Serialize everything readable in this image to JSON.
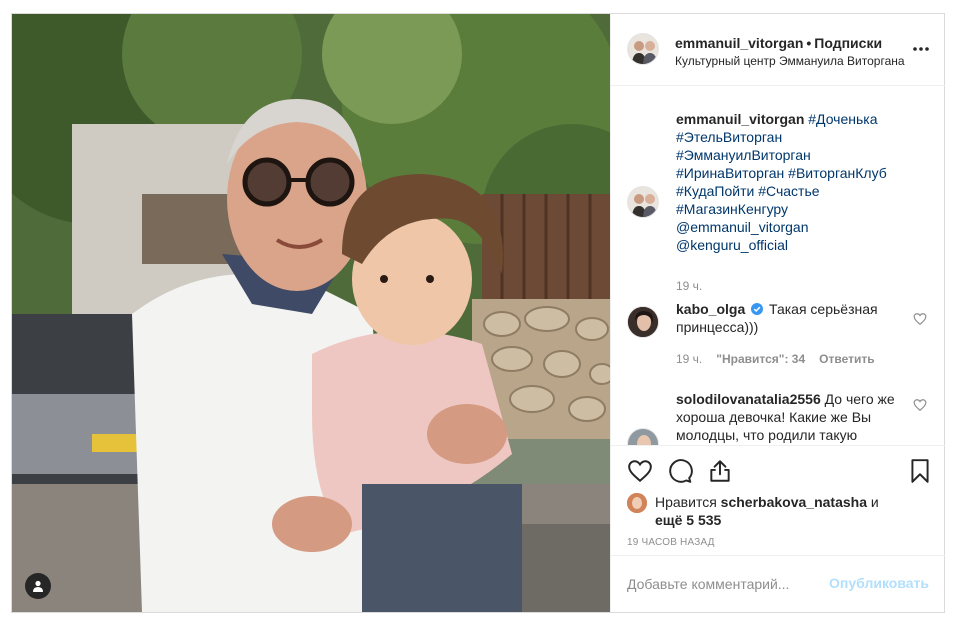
{
  "header": {
    "username": "emmanuil_vitorgan",
    "separator": "•",
    "follow_label": "Подписки",
    "location": "Культурный центр Эммануила Виторгана",
    "more_icon": "more-horizontal-icon"
  },
  "caption": {
    "username": "emmanuil_vitorgan",
    "tags": [
      "#Доченька",
      "#ЭтельВиторган",
      "#ЭммануилВиторган",
      "#ИринаВиторган",
      "#ВиторганКлуб",
      "#КудаПойти",
      "#Счастье",
      "#МагазинКенгуру",
      "@emmanuil_vitorgan",
      "@kenguru_official"
    ],
    "time": "19 ч."
  },
  "comments": [
    {
      "username": "kabo_olga",
      "verified": true,
      "text": "Такая серьёзная принцесса)))",
      "time": "19 ч.",
      "likes": "\"Нравится\": 34",
      "reply": "Ответить"
    },
    {
      "username": "solodilovanatalia2556",
      "verified": false,
      "text": "До чего же хороша девочка! Какие же Вы молодцы, что родили такую"
    }
  ],
  "actions": {
    "like_icon": "heart-icon",
    "comment_icon": "comment-icon",
    "share_icon": "share-icon",
    "save_icon": "bookmark-icon",
    "likes_prefix": "Нравится",
    "likes_user": "scherbakova_natasha",
    "likes_mid": "и",
    "likes_count": "ещё 5 535",
    "timestamp": "19 часов назад"
  },
  "add_comment": {
    "placeholder": "Добавьте комментарий...",
    "post_label": "Опубликовать"
  },
  "colors": {
    "link": "#00376b",
    "muted": "#8e8e8e",
    "post_button_disabled": "#b2dffc",
    "border": "#efefef",
    "verified": "#3897f0"
  }
}
